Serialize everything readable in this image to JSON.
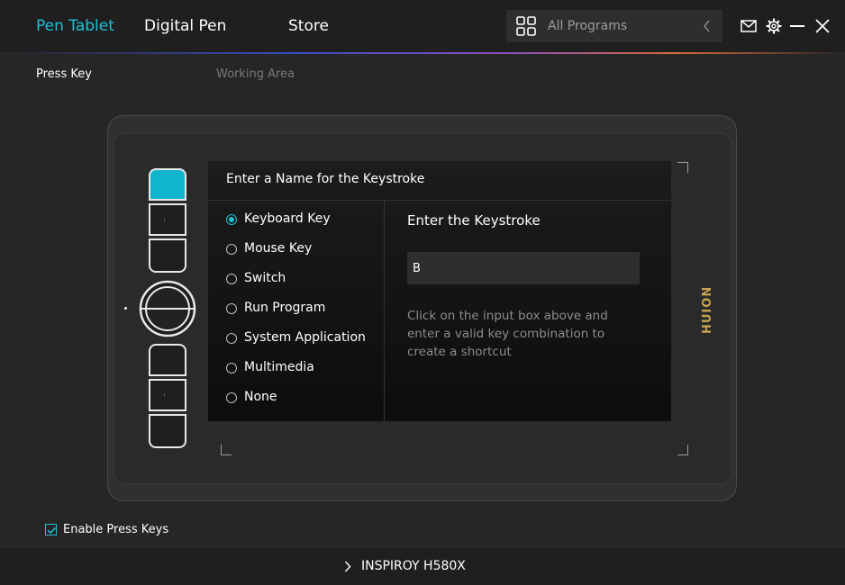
{
  "header": {
    "tabs": [
      {
        "label": "Pen Tablet",
        "active": true
      },
      {
        "label": "Digital Pen",
        "active": false
      },
      {
        "label": "Store",
        "active": false
      }
    ],
    "program_selector": {
      "label": "All Programs",
      "icon": "grid-icon"
    },
    "window_icons": [
      "mail-icon",
      "gear-icon",
      "minimize-icon",
      "close-icon"
    ]
  },
  "subtabs": [
    {
      "label": "Press Key",
      "active": true
    },
    {
      "label": "Working Area",
      "active": false
    }
  ],
  "tablet": {
    "brand": "HUION",
    "press_keys_count": 6,
    "selected_key": 1
  },
  "dialog": {
    "title": "Enter a Name for the Keystroke",
    "options": [
      {
        "label": "Keyboard Key",
        "checked": true
      },
      {
        "label": "Mouse Key",
        "checked": false
      },
      {
        "label": "Switch",
        "checked": false
      },
      {
        "label": "Run Program",
        "checked": false
      },
      {
        "label": "System Application",
        "checked": false
      },
      {
        "label": "Multimedia",
        "checked": false
      },
      {
        "label": "None",
        "checked": false
      }
    ],
    "keystroke_heading": "Enter the Keystroke",
    "keystroke_value": "B",
    "hint": "Click on the input box above and enter a valid key combination to create a shortcut"
  },
  "enable_press_keys": {
    "label": "Enable Press Keys",
    "checked": true
  },
  "footer": {
    "device_name": "INSPIROY H580X"
  },
  "colors": {
    "accent": "#1ec0d6",
    "brand": "#c9a24e",
    "background": "#262626"
  }
}
